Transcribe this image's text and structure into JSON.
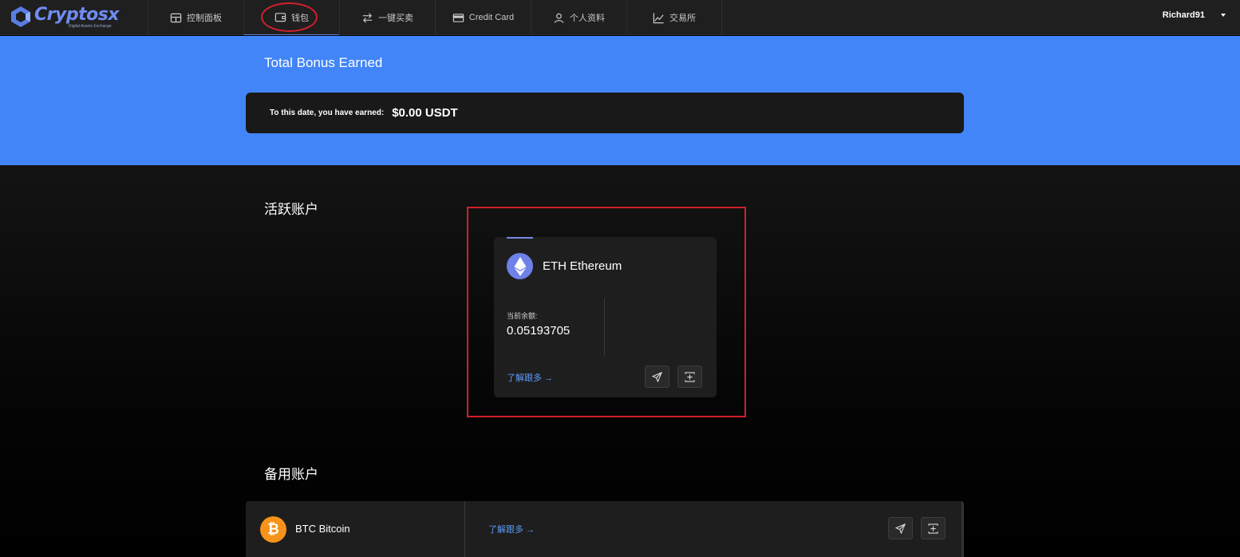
{
  "brand": {
    "name": "Cryptosx",
    "tagline": "Digital Assets Exchange"
  },
  "nav": {
    "items": [
      {
        "label": "控制面板",
        "icon": "dashboard-icon"
      },
      {
        "label": "钱包",
        "icon": "wallet-icon"
      },
      {
        "label": "一键买卖",
        "icon": "swap-arrows-icon"
      },
      {
        "label": "Credit Card",
        "icon": "credit-card-icon"
      },
      {
        "label": "个人资料",
        "icon": "user-icon"
      },
      {
        "label": "交易所",
        "icon": "chart-line-icon"
      }
    ],
    "active_index": 1
  },
  "user": {
    "name": "Richard91"
  },
  "bonus": {
    "title": "Total Bonus Earned",
    "label": "To this date, you have earned:",
    "value": "$0.00 USDT"
  },
  "active_accounts": {
    "title": "活跃账户",
    "cards": [
      {
        "coin": "ETH Ethereum",
        "balance_label": "当前余额:",
        "balance": "0.05193705",
        "learn_more": "了解跟多 →",
        "icon": "ethereum-icon"
      }
    ]
  },
  "backup_accounts": {
    "title": "备用账户",
    "rows": [
      {
        "coin": "BTC Bitcoin",
        "learn_more": "了解跟多 →",
        "icon": "bitcoin-icon",
        "icon_glyph": "₿"
      }
    ]
  },
  "colors": {
    "accent_blue": "#4285f9",
    "annotation_red": "#d0202a",
    "eth": "#6f80e8",
    "btc": "#f7931a",
    "link": "#5c9cf7"
  }
}
